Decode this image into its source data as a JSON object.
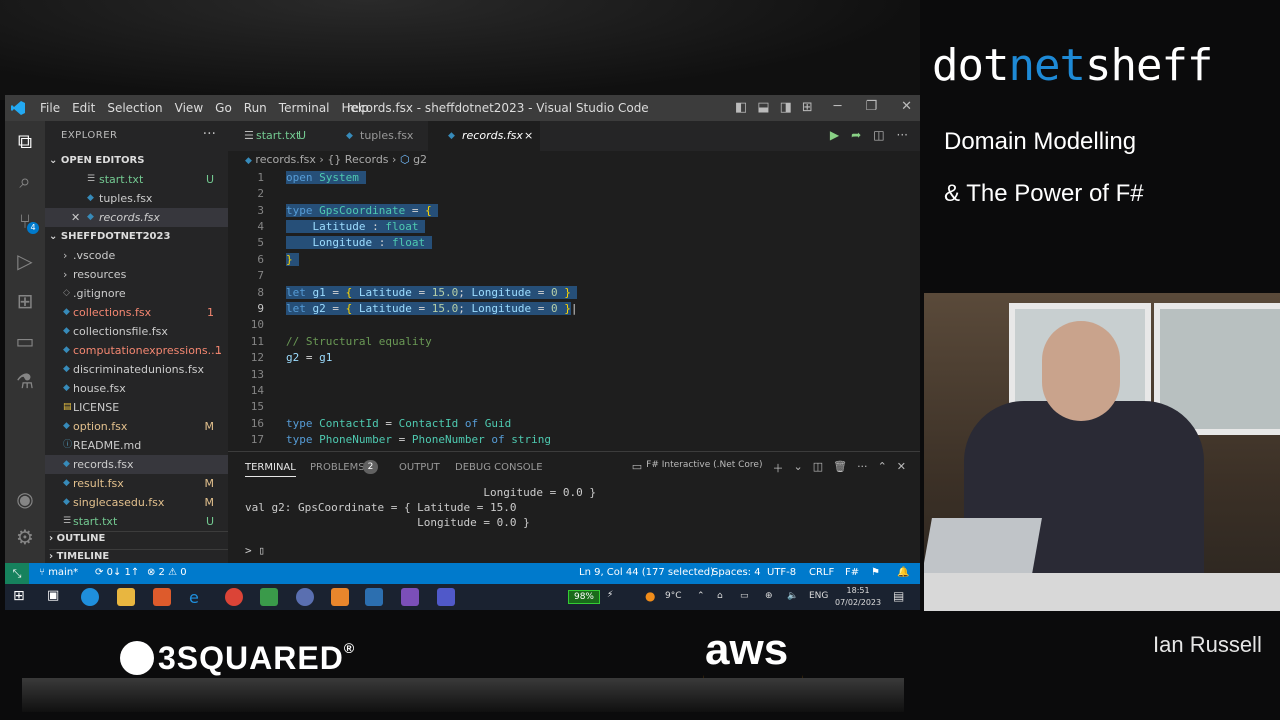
{
  "window": {
    "menu": [
      "File",
      "Edit",
      "Selection",
      "View",
      "Go",
      "Run",
      "Terminal",
      "Help"
    ],
    "title": "records.fsx - sheffdotnet2023 - Visual Studio Code"
  },
  "explorer": {
    "header": "EXPLORER",
    "open_editors_label": "OPEN EDITORS",
    "open_editors": [
      {
        "name": "start.txt",
        "status": "U"
      },
      {
        "name": "tuples.fsx",
        "status": ""
      },
      {
        "name": "records.fsx",
        "status": ""
      }
    ],
    "project_label": "SHEFFDOTNET2023",
    "files": [
      {
        "name": ".vscode",
        "status": ""
      },
      {
        "name": "resources",
        "status": ""
      },
      {
        "name": ".gitignore",
        "status": ""
      },
      {
        "name": "collections.fsx",
        "status": "1"
      },
      {
        "name": "collectionsfile.fsx",
        "status": ""
      },
      {
        "name": "computationexpressions....",
        "status": "1"
      },
      {
        "name": "discriminatedunions.fsx",
        "status": ""
      },
      {
        "name": "house.fsx",
        "status": ""
      },
      {
        "name": "LICENSE",
        "status": ""
      },
      {
        "name": "option.fsx",
        "status": "M"
      },
      {
        "name": "README.md",
        "status": ""
      },
      {
        "name": "records.fsx",
        "status": ""
      },
      {
        "name": "result.fsx",
        "status": "M"
      },
      {
        "name": "singlecasedu.fsx",
        "status": "M"
      },
      {
        "name": "start.txt",
        "status": "U"
      }
    ],
    "outline_label": "OUTLINE",
    "timeline_label": "TIMELINE"
  },
  "tabs": [
    {
      "label": "start.txt",
      "status": "U"
    },
    {
      "label": "tuples.fsx",
      "status": ""
    },
    {
      "label": "records.fsx",
      "status": "×"
    }
  ],
  "breadcrumb": {
    "file": "records.fsx",
    "module": "{} Records",
    "symbol": "g2"
  },
  "editor": {
    "line_numbers": [
      "1",
      "2",
      "3",
      "4",
      "5",
      "6",
      "7",
      "8",
      "9",
      "10",
      "11",
      "12",
      "13",
      "14",
      "15",
      "16",
      "17"
    ]
  },
  "panel": {
    "tabs": [
      "TERMINAL",
      "PROBLEMS",
      "OUTPUT",
      "DEBUG CONSOLE"
    ],
    "problems_count": "2",
    "terminal_name": "F# Interactive (.Net Core)",
    "lines": [
      "                  Longitude = 0.0 }",
      "val g2: GpsCoordinate = { Latitude = 15.0",
      "                          Longitude = 0.0 }",
      "> ▯"
    ]
  },
  "statusbar": {
    "branch": "main*",
    "sync": "0↓ 1↑",
    "problems": "⊗ 2 ⚠ 0",
    "position": "Ln 9, Col 44 (177 selected)",
    "spaces": "Spaces: 4",
    "encoding": "UTF-8",
    "eol": "CRLF",
    "language": "F#"
  },
  "taskbar": {
    "battery": "98%",
    "temperature": "9°C",
    "lang": "ENG",
    "time": "18:51",
    "date": "07/02/2023"
  },
  "overlay": {
    "brand_pre": "dot",
    "brand_net": "net",
    "brand_post": "sheff",
    "talk_line1": "Domain Modelling",
    "talk_line2": "& The Power of F#",
    "sponsor1": "3SQUARED",
    "sponsor2": "aws",
    "speaker": "Ian Russell"
  },
  "colors": {
    "accent": "#007acc",
    "selection": "#264f78",
    "brand_blue": "#1e8ad6"
  }
}
